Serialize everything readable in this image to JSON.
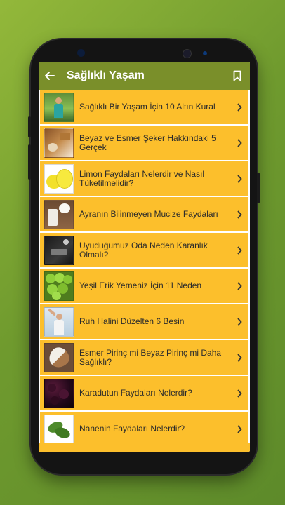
{
  "appbar": {
    "title": "Sağlıklı Yaşam",
    "back_icon": "back-arrow-icon",
    "bookmark_icon": "bookmark-icon",
    "color": "#7a8f2a"
  },
  "list": {
    "row_color": "#fcbf2c",
    "items": [
      {
        "label": "Sağlıklı Bir Yaşam İçin 10 Altın Kural",
        "thumb": "woman-nature-thumbnail"
      },
      {
        "label": "Beyaz ve Esmer Şeker Hakkındaki 5 Gerçek",
        "thumb": "sugar-thumbnail"
      },
      {
        "label": "Limon Faydaları Nelerdir ve Nasıl Tüketilmelidir?",
        "thumb": "lemon-thumbnail"
      },
      {
        "label": "Ayranın Bilinmeyen Mucize Faydaları",
        "thumb": "ayran-thumbnail"
      },
      {
        "label": "Uyuduğumuz Oda Neden Karanlık Olmalı?",
        "thumb": "dark-room-thumbnail"
      },
      {
        "label": "Yeşil Erik Yemeniz İçin 11 Neden",
        "thumb": "green-plum-thumbnail"
      },
      {
        "label": "Ruh Halini Düzelten 6 Besin",
        "thumb": "happy-woman-thumbnail"
      },
      {
        "label": "Esmer Pirinç mi Beyaz Pirinç mi Daha Sağlıklı?",
        "thumb": "rice-thumbnail"
      },
      {
        "label": "Karadutun Faydaları Nelerdir?",
        "thumb": "blackberry-thumbnail"
      },
      {
        "label": "Nanenin Faydaları Nelerdir?",
        "thumb": "mint-thumbnail"
      }
    ]
  }
}
